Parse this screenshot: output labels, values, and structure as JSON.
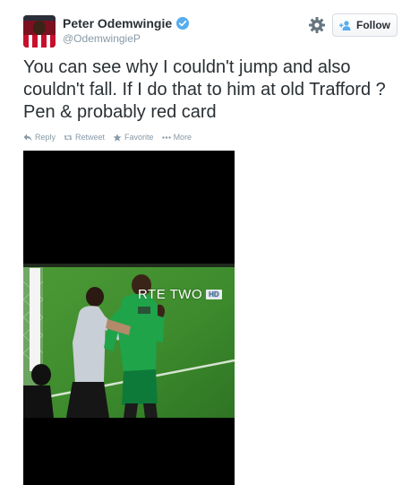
{
  "user": {
    "name": "Peter Odemwingie",
    "handle": "@OdemwingieP",
    "verified": true
  },
  "header": {
    "follow_label": "Follow",
    "settings_icon": "gear-icon",
    "follow_icon": "add-user-icon"
  },
  "tweet": {
    "text": "You can see why I couldn't jump and also couldn't fall. If I do that to him at old Trafford ? Pen & probably red card"
  },
  "actions": [
    {
      "label": "Reply",
      "icon": "reply-icon"
    },
    {
      "label": "Retweet",
      "icon": "retweet-icon"
    },
    {
      "label": "Favorite",
      "icon": "star-icon"
    },
    {
      "label": "More",
      "icon": "more-icon"
    }
  ],
  "media": {
    "broadcast_logo": "RTE TWO",
    "hd_badge": "HD"
  },
  "colors": {
    "text": "#292f33",
    "muted": "#8899a6",
    "verified_blue": "#55acee",
    "pitch_green": "#3f8a2e"
  }
}
